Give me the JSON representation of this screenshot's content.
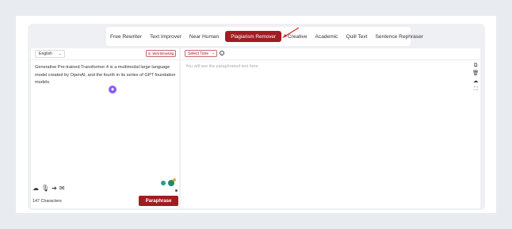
{
  "tabs": [
    {
      "label": "Free Rewriter",
      "active": false
    },
    {
      "label": "Text Improver",
      "active": false
    },
    {
      "label": "Near Human",
      "active": false
    },
    {
      "label": "Plagiarism Remover",
      "active": true
    },
    {
      "label": "Creative",
      "active": false
    },
    {
      "label": "Academic",
      "active": false
    },
    {
      "label": "Quill Text",
      "active": false
    },
    {
      "label": "Sentence Rephraser",
      "active": false
    }
  ],
  "left_panel": {
    "language": "English",
    "web_browsing_label": "Web Browsing",
    "input_text": "Generative Pre-trained Transformer 4 is a multimodal large language model created by OpenAI, and the fourth in its series of GPT foundation models.",
    "char_count": "147 Characters",
    "paraphrase_label": "Paraphrase"
  },
  "right_panel": {
    "tone_select": "Select Tone",
    "placeholder": "You will see the paraphrased text here."
  },
  "colors": {
    "accent": "#a01c22",
    "background": "#e8ebef"
  }
}
